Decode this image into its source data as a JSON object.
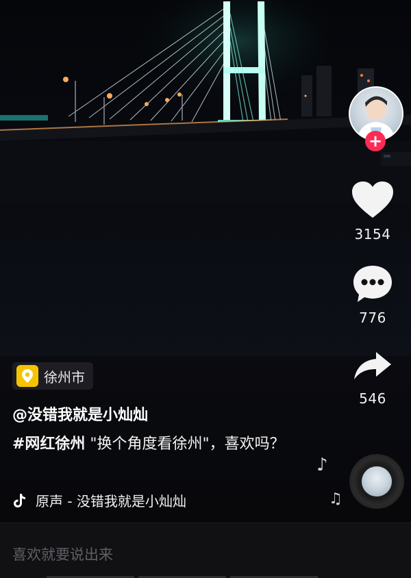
{
  "rail": {
    "likes": "3154",
    "comments": "776",
    "shares": "546",
    "follow_symbol": "+"
  },
  "post": {
    "location": "徐州市",
    "username": "@没错我就是小灿灿",
    "hashtag": "#网红徐州",
    "caption_rest": " \"换个角度看徐州\"，喜欢吗？",
    "music": "原声 - 没错我就是小灿灿"
  },
  "comment_bar": {
    "placeholder": "喜欢就要说出来"
  },
  "colors": {
    "accent_red": "#fe2c55",
    "location_yellow": "#f5c400"
  }
}
